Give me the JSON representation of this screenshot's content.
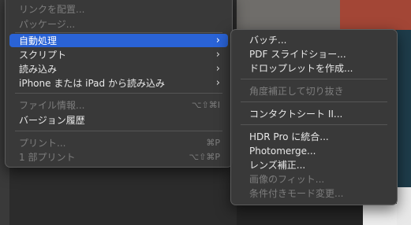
{
  "main_menu": {
    "items": [
      {
        "label": "リンクを配置...",
        "disabled": true
      },
      {
        "label": "パッケージ...",
        "disabled": true
      },
      {
        "label": "自動処理",
        "highlight": true,
        "submenu": true
      },
      {
        "label": "スクリプト",
        "submenu": true
      },
      {
        "label": "読み込み",
        "submenu": true
      },
      {
        "label": "iPhone または iPad から読み込み",
        "submenu": true
      },
      {
        "label": "ファイル情報...",
        "disabled": true,
        "shortcut": "⌥⇧⌘I"
      },
      {
        "label": "バージョン履歴"
      },
      {
        "label": "プリント...",
        "disabled": true,
        "shortcut": "⌘P"
      },
      {
        "label": "1 部プリント",
        "disabled": true,
        "shortcut": "⌥⇧⌘P"
      }
    ]
  },
  "submenu": {
    "items": [
      {
        "label": "バッチ..."
      },
      {
        "label": "PDF スライドショー..."
      },
      {
        "label": "ドロップレットを作成..."
      },
      {
        "label": "角度補正して切り抜き",
        "disabled": true
      },
      {
        "label": "コンタクトシート II..."
      },
      {
        "label": "HDR Pro に統合..."
      },
      {
        "label": "Photomerge..."
      },
      {
        "label": "レンズ補正..."
      },
      {
        "label": "画像のフィット...",
        "disabled": true
      },
      {
        "label": "条件付きモード変更...",
        "disabled": true
      }
    ]
  },
  "icons": {
    "submenu_arrow": "›"
  }
}
